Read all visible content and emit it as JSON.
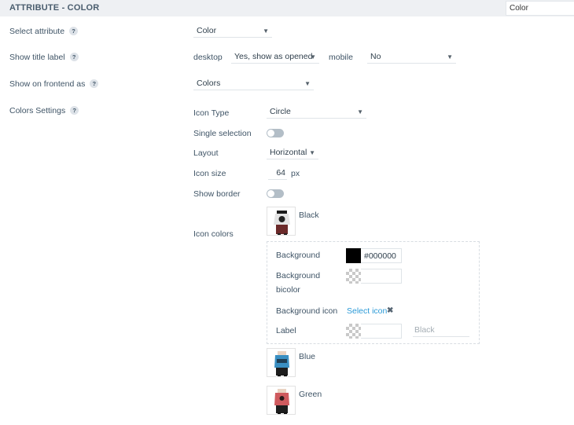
{
  "header": {
    "title": "ATTRIBUTE - COLOR",
    "search_value": "Color"
  },
  "help_glyph": "?",
  "arrow_glyph": "▼",
  "rows": {
    "select_attribute": {
      "label": "Select attribute",
      "value": "Color"
    },
    "show_title_label": {
      "label": "Show title label",
      "desktop_label": "desktop",
      "desktop_value": "Yes, show as opened",
      "mobile_label": "mobile",
      "mobile_value": "No"
    },
    "show_on_frontend": {
      "label": "Show on frontend as",
      "value": "Colors"
    },
    "colors_settings": {
      "label": "Colors Settings"
    }
  },
  "colors_settings": {
    "icon_type": {
      "label": "Icon Type",
      "value": "Circle"
    },
    "single_selection": {
      "label": "Single selection",
      "on": false
    },
    "layout": {
      "label": "Layout",
      "value": "Horizontal"
    },
    "icon_size": {
      "label": "Icon size",
      "value": "64",
      "unit": "px"
    },
    "show_border": {
      "label": "Show border",
      "on": false
    },
    "icon_colors_label": "Icon colors"
  },
  "colors": [
    {
      "name": "Black",
      "background_label": "Background",
      "background_value": "#000000",
      "background_swatch": "#000000",
      "bicolor_label_1": "Background",
      "bicolor_label_2": "bicolor",
      "background_icon_label": "Background icon",
      "select_icon_label": "Select icon",
      "remove_glyph": "✖",
      "label_label": "Label",
      "label_placeholder": "Black"
    },
    {
      "name": "Blue",
      "shirt_color": "#3a8fc2"
    },
    {
      "name": "Green",
      "shirt_color": "#cf5a5e"
    }
  ]
}
